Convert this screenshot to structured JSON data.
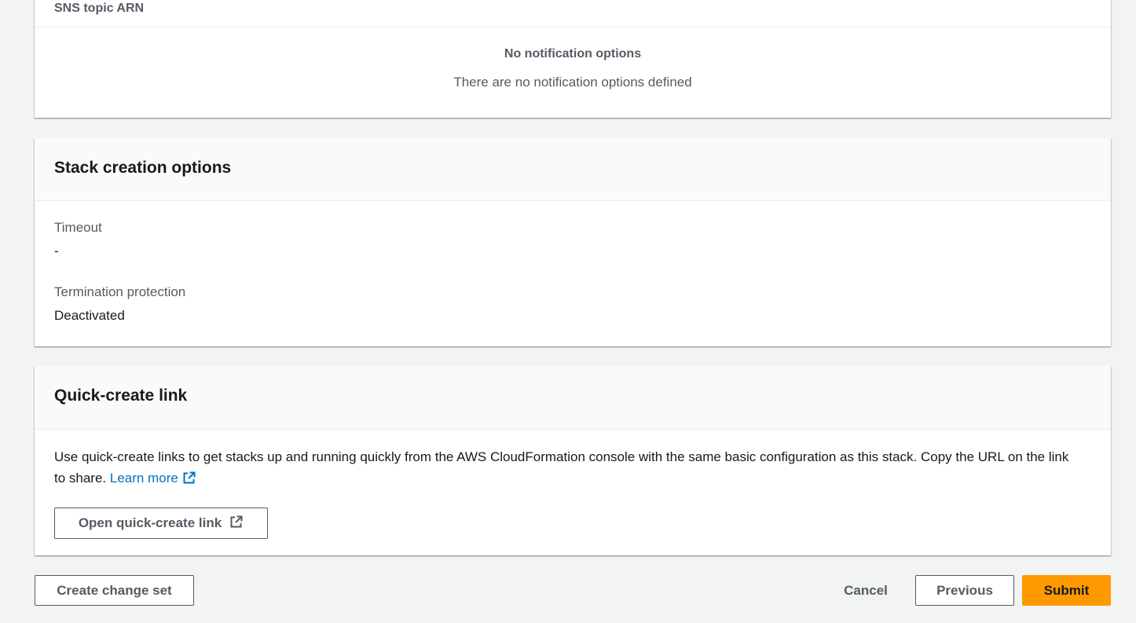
{
  "notifications": {
    "column_header": "SNS topic ARN",
    "empty_title": "No notification options",
    "empty_description": "There are no notification options defined"
  },
  "stack_creation": {
    "title": "Stack creation options",
    "timeout_label": "Timeout",
    "timeout_value": "-",
    "termination_label": "Termination protection",
    "termination_value": "Deactivated"
  },
  "quick_create": {
    "title": "Quick-create link",
    "description": "Use quick-create links to get stacks up and running quickly from the AWS CloudFormation console with the same basic configuration as this stack. Copy the URL on the link to share.",
    "learn_more": "Learn more",
    "open_button": "Open quick-create link",
    "icon": "external-link-icon"
  },
  "footer": {
    "create_change_set": "Create change set",
    "cancel": "Cancel",
    "previous": "Previous",
    "submit": "Submit"
  },
  "colors": {
    "accent": "#ff9900",
    "link": "#0073bb",
    "background": "#f2f3f3"
  }
}
